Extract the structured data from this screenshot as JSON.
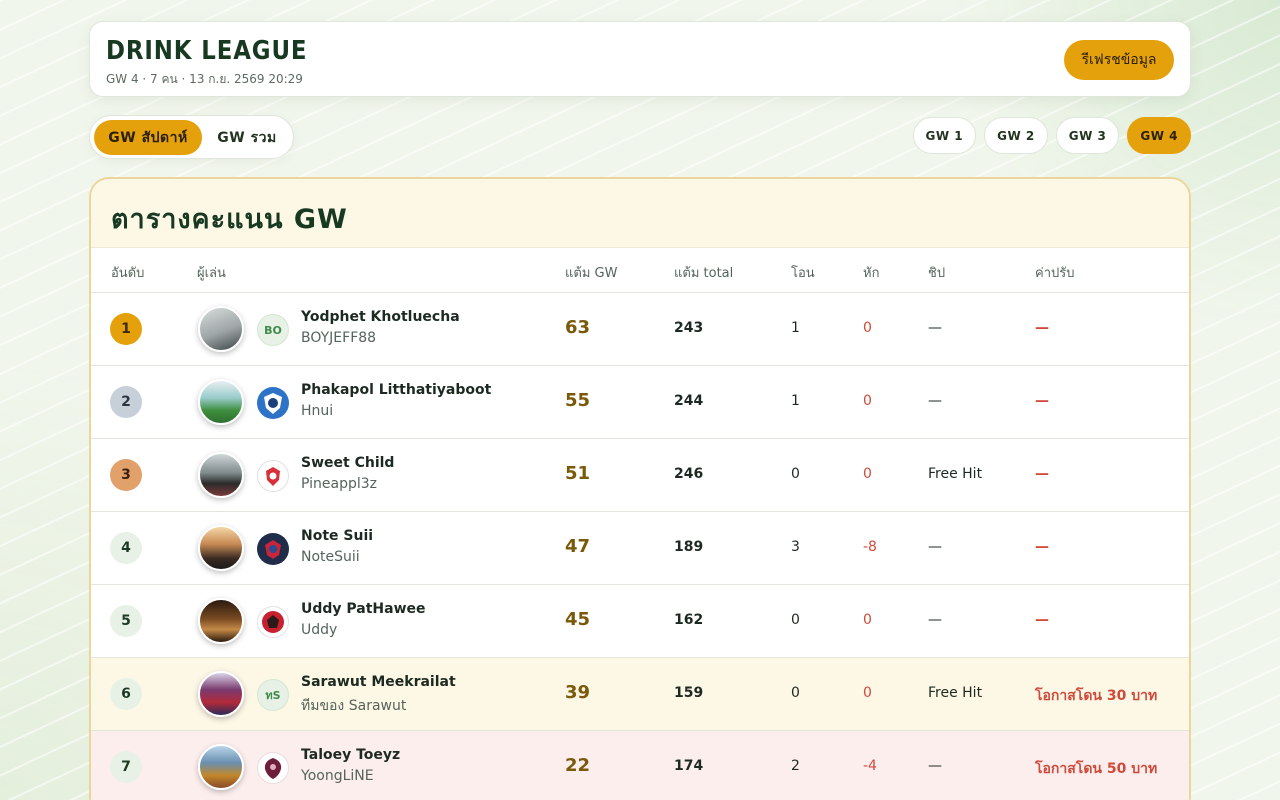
{
  "header": {
    "title": "DRINK LEAGUE",
    "subtitle": "GW 4 · 7 คน · 13 ก.ย. 2569 20:29",
    "refresh_label": "รีเฟรชข้อมูล"
  },
  "mode_toggle": {
    "weekly_label": "GW สัปดาห์",
    "overall_label": "GW รวม",
    "active": "weekly"
  },
  "gw_tabs": [
    {
      "label": "GW 1",
      "active": false
    },
    {
      "label": "GW 2",
      "active": false
    },
    {
      "label": "GW 3",
      "active": false
    },
    {
      "label": "GW 4",
      "active": true
    }
  ],
  "board": {
    "title": "ตารางคะแนน GW",
    "columns": {
      "rank": "อันดับ",
      "player": "ผู้เล่น",
      "gw_points": "แต้ม GW",
      "total_points": "แต้ม total",
      "transfers": "โอน",
      "hits": "หัก",
      "chip": "ชิป",
      "fine": "ค่าปรับ"
    },
    "rows": [
      {
        "rank": "1",
        "name": "Yodphet Khotluecha",
        "team": "BOYJEFF88",
        "crest": "BO",
        "gw": "63",
        "total": "243",
        "transfers": "1",
        "hits": "0",
        "chip": "—",
        "fine": "—"
      },
      {
        "rank": "2",
        "name": "Phakapol Litthatiyaboot",
        "team": "Hnui",
        "crest": "",
        "gw": "55",
        "total": "244",
        "transfers": "1",
        "hits": "0",
        "chip": "—",
        "fine": "—"
      },
      {
        "rank": "3",
        "name": "Sweet Child",
        "team": "Pineappl3z",
        "crest": "",
        "gw": "51",
        "total": "246",
        "transfers": "0",
        "hits": "0",
        "chip": "Free Hit",
        "fine": "—"
      },
      {
        "rank": "4",
        "name": "Note Suii",
        "team": "NoteSuii",
        "crest": "",
        "gw": "47",
        "total": "189",
        "transfers": "3",
        "hits": "-8",
        "chip": "—",
        "fine": "—"
      },
      {
        "rank": "5",
        "name": "Uddy PatHawee",
        "team": "Uddy",
        "crest": "",
        "gw": "45",
        "total": "162",
        "transfers": "0",
        "hits": "0",
        "chip": "—",
        "fine": "—"
      },
      {
        "rank": "6",
        "name": "Sarawut Meekrailat",
        "team": "ทีมของ Sarawut",
        "crest": "ทS",
        "gw": "39",
        "total": "159",
        "transfers": "0",
        "hits": "0",
        "chip": "Free Hit",
        "fine": "โอกาสโดน 30 บาท"
      },
      {
        "rank": "7",
        "name": "Taloey Toeyz",
        "team": "YoongLiNE",
        "crest": "",
        "gw": "22",
        "total": "174",
        "transfers": "2",
        "hits": "-4",
        "chip": "—",
        "fine": "โอกาสโดน 50 บาท"
      }
    ]
  },
  "colors": {
    "accent": "#e5a10c",
    "title": "#173821",
    "penalty": "#d04a3a",
    "warn_row": "#fdf7e6",
    "danger_row": "#fdeeee"
  }
}
